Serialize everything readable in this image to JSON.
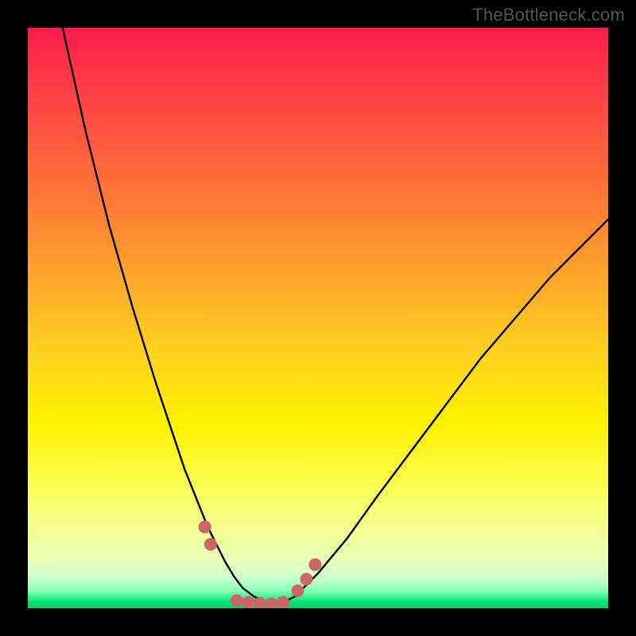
{
  "watermark": "TheBottleneck.com",
  "chart_data": {
    "type": "line",
    "title": "",
    "xlabel": "",
    "ylabel": "",
    "xlim": [
      0,
      100
    ],
    "ylim": [
      0,
      100
    ],
    "grid": false,
    "legend": false,
    "series": [
      {
        "name": "left-curve",
        "x": [
          6,
          10,
          14,
          18,
          22,
          25,
          27,
          29,
          31,
          32.5,
          34,
          35.5,
          37,
          39,
          41,
          43
        ],
        "y": [
          100,
          82,
          66,
          52,
          39,
          30,
          24,
          19,
          14,
          11,
          8,
          5.5,
          3.5,
          2,
          1,
          0.5
        ]
      },
      {
        "name": "right-curve",
        "x": [
          43,
          46,
          50,
          55,
          60,
          66,
          72,
          78,
          84,
          90,
          96,
          100
        ],
        "y": [
          0.5,
          2,
          6,
          12,
          19,
          27,
          35,
          43,
          50,
          57,
          63,
          67
        ]
      }
    ],
    "markers": {
      "name": "highlight-points",
      "color": "#cc6666",
      "points": [
        {
          "x": 30.5,
          "y": 14
        },
        {
          "x": 31.5,
          "y": 11
        },
        {
          "x": 36,
          "y": 1.3
        },
        {
          "x": 38,
          "y": 1.0
        },
        {
          "x": 40,
          "y": 0.8
        },
        {
          "x": 42,
          "y": 0.7
        },
        {
          "x": 44,
          "y": 1.0
        },
        {
          "x": 46.5,
          "y": 3.0
        },
        {
          "x": 48,
          "y": 5.0
        },
        {
          "x": 49.5,
          "y": 7.5
        }
      ]
    }
  }
}
